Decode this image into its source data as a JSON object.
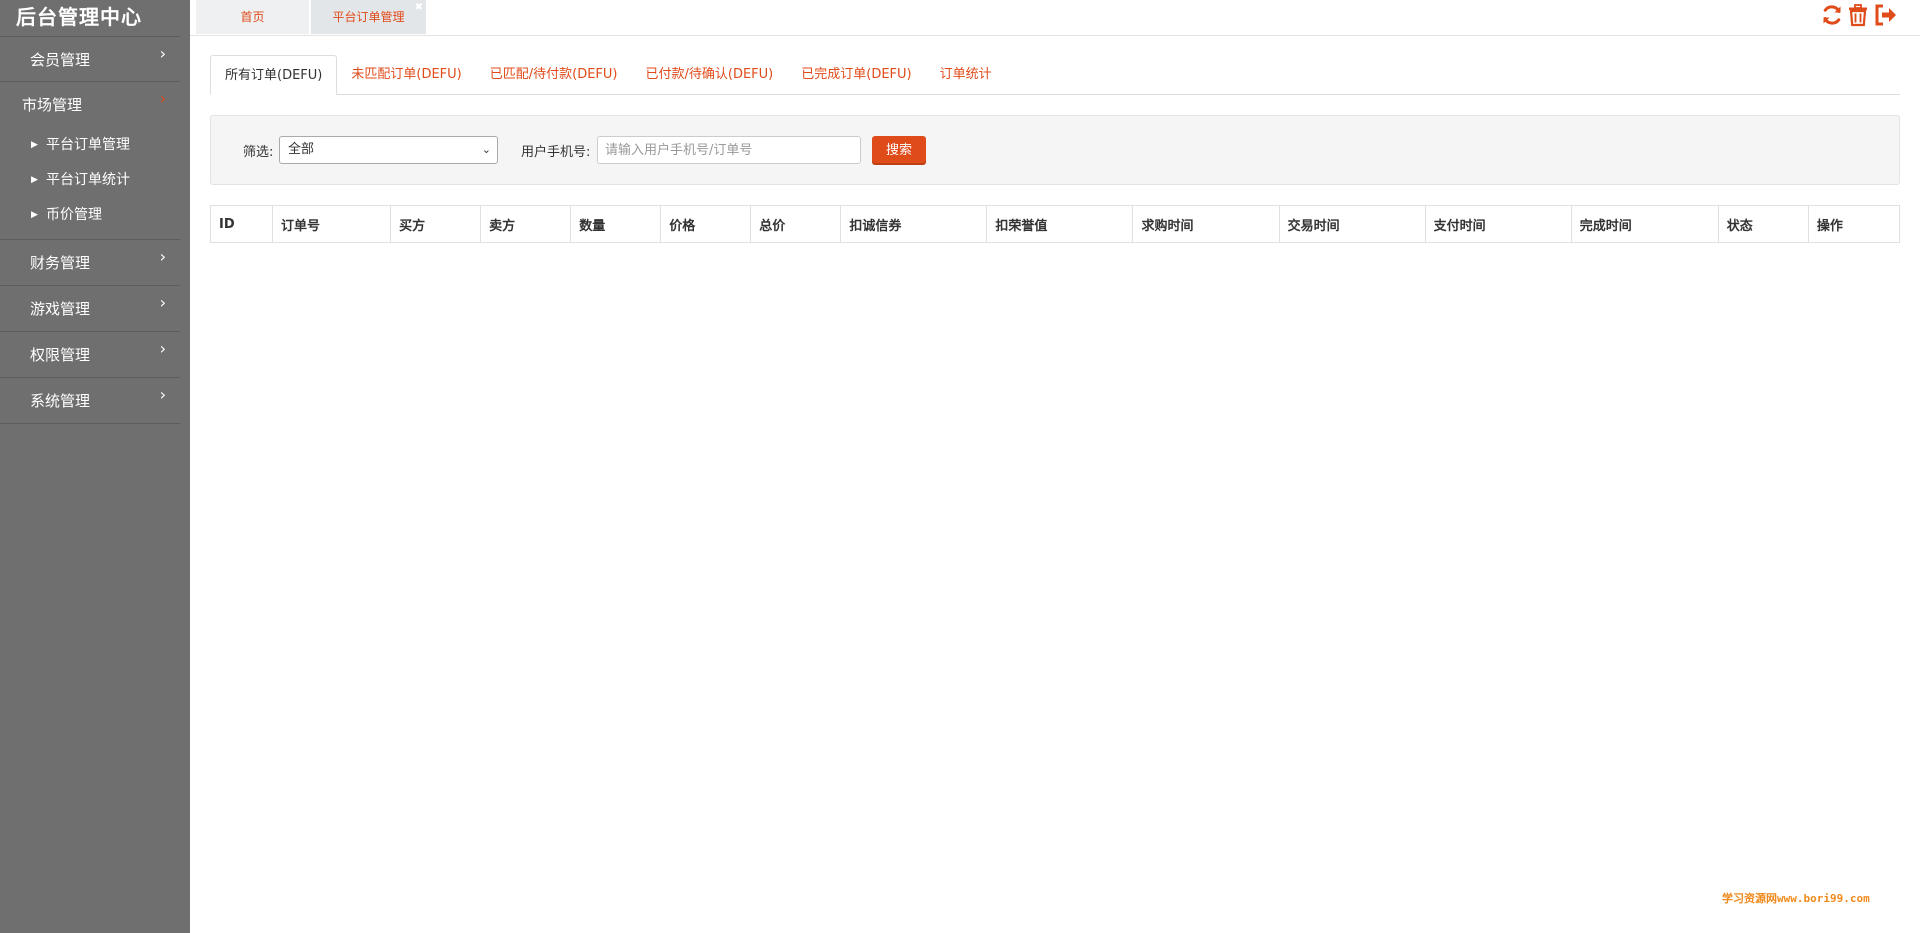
{
  "app": {
    "title": "后台管理中心"
  },
  "sidebar": {
    "items": [
      {
        "label": "会员管理"
      },
      {
        "label": "市场管理",
        "children": [
          "平台订单管理",
          "平台订单统计",
          "币价管理"
        ]
      },
      {
        "label": "财务管理"
      },
      {
        "label": "游戏管理"
      },
      {
        "label": "权限管理"
      },
      {
        "label": "系统管理"
      }
    ]
  },
  "topbar": {
    "tabs": [
      {
        "label": "首页"
      },
      {
        "label": "平台订单管理"
      }
    ],
    "icons": [
      "refresh-icon",
      "trash-icon",
      "logout-icon"
    ],
    "accent": "#e04b1a"
  },
  "content_tabs": [
    "所有订单(DEFU)",
    "未匹配订单(DEFU)",
    "已匹配/待付款(DEFU)",
    "已付款/待确认(DEFU)",
    "已完成订单(DEFU)",
    "订单统计"
  ],
  "filter": {
    "label": "筛选:",
    "selected": "全部",
    "phone_label": "用户手机号:",
    "phone_placeholder": "请输入用户手机号/订单号",
    "search_label": "搜索"
  },
  "table": {
    "columns": [
      "ID",
      "订单号",
      "买方",
      "卖方",
      "数量",
      "价格",
      "总价",
      "扣诚信券",
      "扣荣誉值",
      "求购时间",
      "交易时间",
      "支付时间",
      "完成时间",
      "状态",
      "操作"
    ]
  },
  "watermark": "学习资源网www.bori99.com"
}
